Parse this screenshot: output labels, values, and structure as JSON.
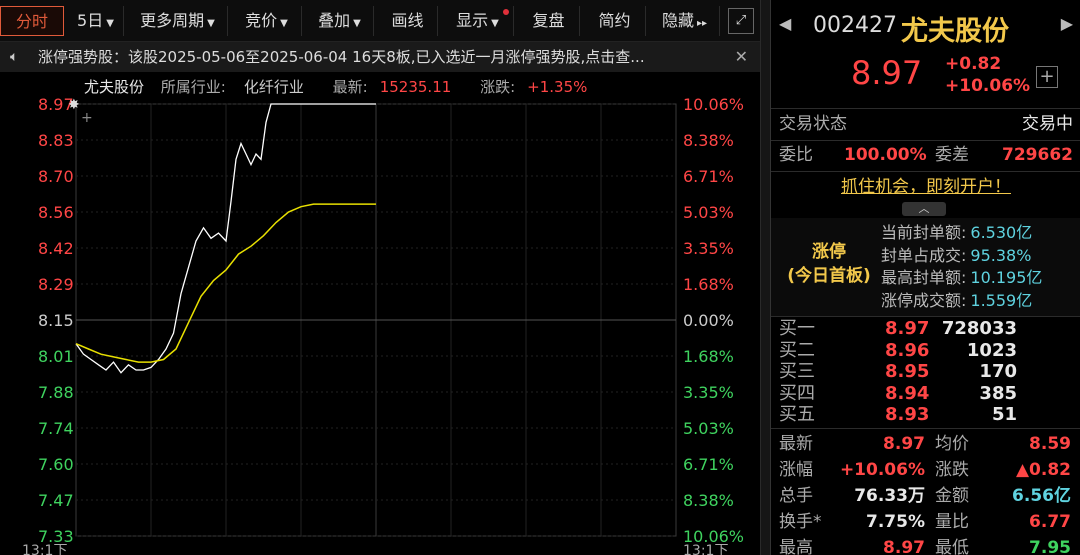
{
  "toolbar": {
    "buttons": [
      {
        "label": "分时",
        "caret": false,
        "active": true
      },
      {
        "label": "5日",
        "caret": true
      },
      {
        "label": "更多周期",
        "caret": true
      },
      {
        "label": "竞价",
        "caret": true
      },
      {
        "label": "叠加",
        "caret": true
      },
      {
        "label": "画线",
        "caret": false
      },
      {
        "label": "显示",
        "caret": true,
        "dot": true
      },
      {
        "label": "复盘",
        "caret": false
      },
      {
        "label": "简约",
        "caret": false
      },
      {
        "label": "隐藏",
        "caret": false,
        "suffix": "▸▸"
      }
    ],
    "expand_icon": "expand-icon"
  },
  "notice": {
    "text": "涨停强势股：该股2025-05-06至2025-06-04 16天8板,已入选近一月涨停强势股,点击查...",
    "close": "✕"
  },
  "chart_header": {
    "name": "尤夫股份",
    "industry_label": "所属行业:",
    "industry": "化纤行业",
    "latest_label": "最新:",
    "latest": "15235.11",
    "change_label": "涨跌:",
    "change": "+1.35%"
  },
  "chart_data": {
    "type": "line",
    "prev_close": 8.15,
    "ylim": [
      7.33,
      8.97
    ],
    "left_ticks": [
      "8.97",
      "8.83",
      "8.70",
      "8.56",
      "8.42",
      "8.29",
      "8.15",
      "8.01",
      "7.88",
      "7.74",
      "7.60",
      "7.47",
      "7.33"
    ],
    "right_ticks": [
      "10.06%",
      "8.38%",
      "6.71%",
      "5.03%",
      "3.35%",
      "1.68%",
      "0.00%",
      "1.68%",
      "3.35%",
      "5.03%",
      "6.71%",
      "8.38%",
      "10.06%"
    ],
    "x_start_label": "13:1下",
    "x_count": 240,
    "series": [
      {
        "color": "#ffffff",
        "x": [
          0,
          3,
          6,
          9,
          12,
          15,
          18,
          21,
          24,
          27,
          30,
          33,
          36,
          39,
          42,
          45,
          48,
          51,
          54,
          57,
          60,
          62,
          64,
          66,
          68,
          70,
          72,
          74,
          76,
          78,
          80,
          82,
          84,
          86,
          88,
          90,
          92,
          94,
          96,
          98,
          100,
          102,
          104,
          106,
          108,
          110,
          112,
          114,
          116,
          118,
          120
        ],
        "y": [
          8.06,
          8.02,
          8.0,
          7.98,
          7.96,
          7.99,
          7.95,
          7.98,
          7.96,
          7.96,
          7.97,
          8.0,
          8.04,
          8.1,
          8.25,
          8.35,
          8.45,
          8.5,
          8.46,
          8.48,
          8.45,
          8.6,
          8.76,
          8.82,
          8.78,
          8.74,
          8.78,
          8.76,
          8.9,
          8.97,
          8.97,
          8.97,
          8.97,
          8.97,
          8.97,
          8.97,
          8.97,
          8.97,
          8.97,
          8.97,
          8.97,
          8.97,
          8.97,
          8.97,
          8.97,
          8.97,
          8.97,
          8.97,
          8.97,
          8.97,
          8.97
        ]
      },
      {
        "color": "#e8e000",
        "x": [
          0,
          5,
          10,
          15,
          20,
          25,
          30,
          35,
          40,
          45,
          50,
          55,
          60,
          65,
          70,
          75,
          80,
          85,
          90,
          95,
          100,
          105,
          110,
          115,
          120
        ],
        "y": [
          8.06,
          8.04,
          8.02,
          8.01,
          8.0,
          7.99,
          7.99,
          8.0,
          8.04,
          8.14,
          8.24,
          8.3,
          8.34,
          8.4,
          8.43,
          8.47,
          8.52,
          8.56,
          8.58,
          8.59,
          8.59,
          8.59,
          8.59,
          8.59,
          8.59
        ]
      }
    ]
  },
  "panel": {
    "code": "002427",
    "name": "尤夫股份",
    "price": "8.97",
    "change": "+0.82",
    "pct": "+10.06%",
    "status_label": "交易状态",
    "status": "交易中",
    "weibi_label": "委比",
    "weibi": "100.00%",
    "weicha_label": "委差",
    "weicha": "729662",
    "cta": "抓住机会，即刻开户！",
    "zt_title_1": "涨停",
    "zt_title_2": "(今日首板)",
    "zt_lines": [
      {
        "k": "当前封单额:",
        "v": "6.530亿"
      },
      {
        "k": "封单占成交:",
        "v": "95.38%"
      },
      {
        "k": "最高封单额:",
        "v": "10.195亿"
      },
      {
        "k": "涨停成交额:",
        "v": "1.559亿"
      }
    ],
    "bids": [
      {
        "k": "买一",
        "p": "8.97",
        "v": "728033"
      },
      {
        "k": "买二",
        "p": "8.96",
        "v": "1023"
      },
      {
        "k": "买三",
        "p": "8.95",
        "v": "170"
      },
      {
        "k": "买四",
        "p": "8.94",
        "v": "385"
      },
      {
        "k": "买五",
        "p": "8.93",
        "v": "51"
      }
    ],
    "stats": [
      {
        "k": "最新",
        "v": "8.97",
        "c": "#ff4646"
      },
      {
        "k": "均价",
        "v": "8.59",
        "c": "#ff4646"
      },
      {
        "k": "涨幅",
        "v": "+10.06%",
        "c": "#ff4646"
      },
      {
        "k": "涨跌",
        "v": "▲0.82",
        "c": "#ff4646"
      },
      {
        "k": "总手",
        "v": "76.33万",
        "c": "#e8e8e8"
      },
      {
        "k": "金额",
        "v": "6.56亿",
        "c": "#5fd3e0"
      },
      {
        "k": "换手*",
        "v": "7.75%",
        "c": "#e8e8e8"
      },
      {
        "k": "量比",
        "v": "6.77",
        "c": "#ff4646"
      },
      {
        "k": "最高",
        "v": "8.97",
        "c": "#ff4646"
      },
      {
        "k": "最低",
        "v": "7.95",
        "c": "#3fd35f"
      }
    ]
  }
}
